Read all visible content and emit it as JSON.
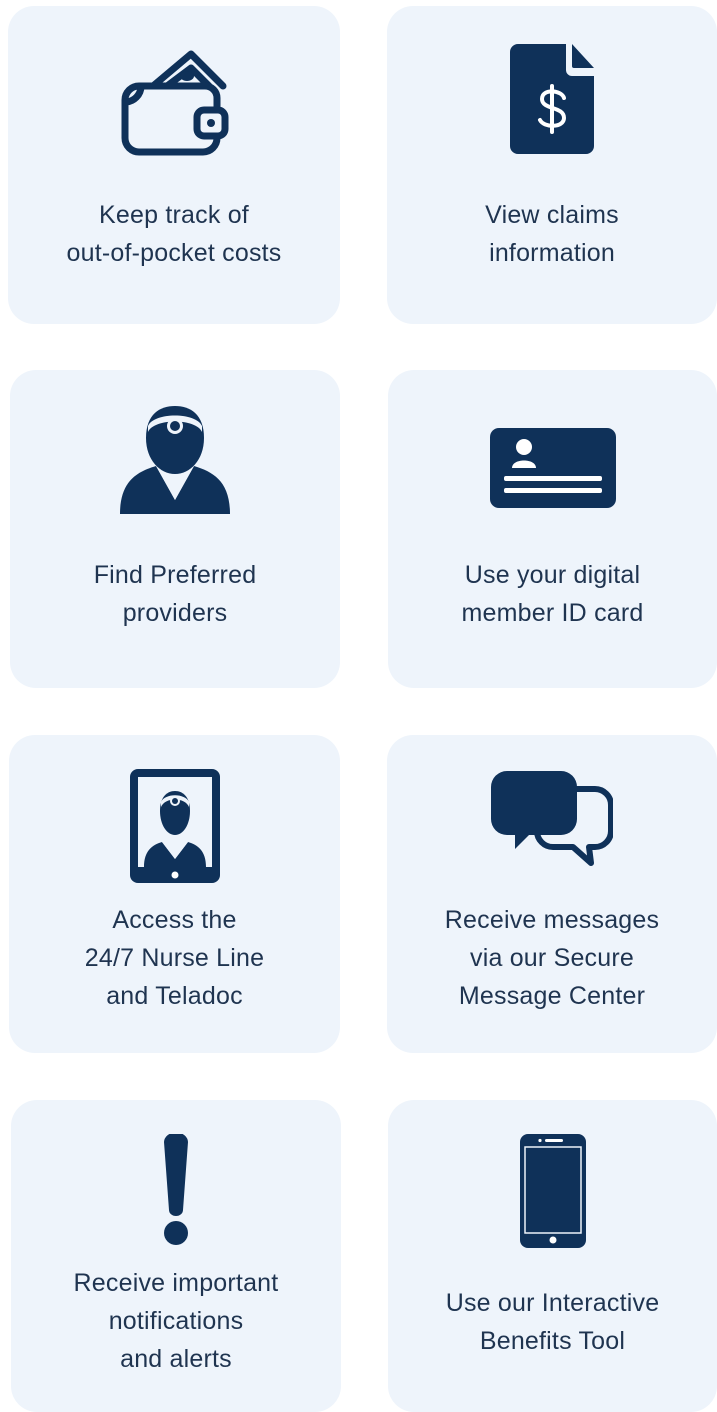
{
  "colors": {
    "card_background": "#eef4fb",
    "icon": "#0f3159",
    "text": "#1f3450"
  },
  "cards": [
    {
      "icon": "wallet-icon",
      "lines": [
        "Keep track of",
        "out-of-pocket costs"
      ]
    },
    {
      "icon": "dollar-document-icon",
      "lines": [
        "View claims",
        "information"
      ]
    },
    {
      "icon": "doctor-icon",
      "lines": [
        "Find Preferred",
        "providers"
      ]
    },
    {
      "icon": "id-card-icon",
      "lines": [
        "Use your digital",
        "member ID card"
      ]
    },
    {
      "icon": "tablet-doctor-icon",
      "lines": [
        "Access the",
        "24/7 Nurse Line",
        "and Teladoc"
      ]
    },
    {
      "icon": "chat-bubbles-icon",
      "lines": [
        "Receive messages",
        "via our Secure",
        "Message Center"
      ]
    },
    {
      "icon": "exclamation-icon",
      "lines": [
        "Receive important",
        "notifications",
        "and alerts"
      ]
    },
    {
      "icon": "smartphone-icon",
      "lines": [
        "Use our Interactive",
        "Benefits Tool"
      ]
    }
  ]
}
